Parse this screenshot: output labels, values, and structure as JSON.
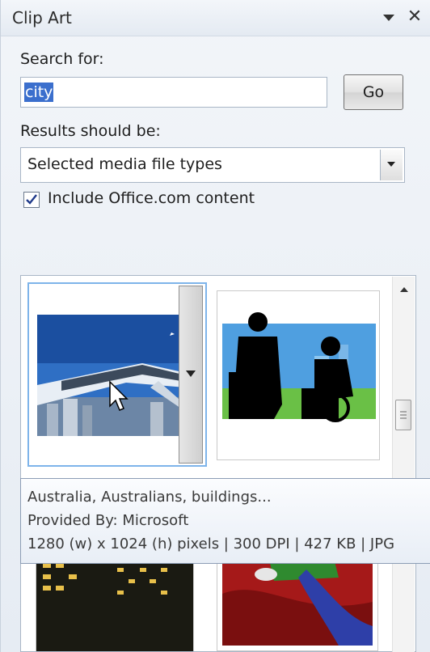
{
  "panel": {
    "title": "Clip Art",
    "menu_icon": "dropdown-triangle-icon",
    "close_label": "✕"
  },
  "search": {
    "label": "Search for:",
    "value": "city",
    "go_label": "Go"
  },
  "results_filter": {
    "label": "Results should be:",
    "selected": "Selected media file types"
  },
  "include_office": {
    "checked": true,
    "label": "Include Office.com content"
  },
  "clips": [
    {
      "name": "monorail-city-clip",
      "selected": true
    },
    {
      "name": "business-silhouettes-clip",
      "selected": false
    },
    {
      "name": "night-buildings-clip",
      "selected": false
    },
    {
      "name": "abstract-red-clip",
      "selected": false
    }
  ],
  "tooltip": {
    "line1": "Australia, Australians, buildings...",
    "line2": "Provided By: Microsoft",
    "line3": "1280 (w) x 1024 (h) pixels | 300 DPI | 427 KB | JPG"
  },
  "colors": {
    "accent": "#7eb4ea",
    "selection": "#3b6fcd"
  }
}
